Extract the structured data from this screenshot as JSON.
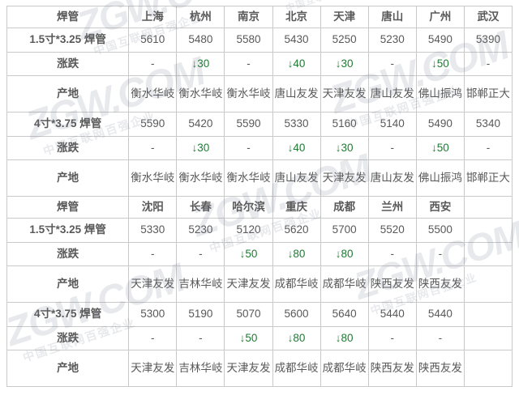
{
  "watermark": {
    "big": "ZGW.COM",
    "small": "中国互联网百强企业"
  },
  "labels": {
    "section_title": "焊管",
    "row_spec_1": "1.5寸*3.25 焊管",
    "row_change": "涨跌",
    "row_origin": "产地",
    "row_spec_2": "4寸*3.75 焊管",
    "blank": ""
  },
  "colors": {
    "section_title": "#ff0000",
    "city": "#1414d2",
    "price": "#666666",
    "change_down": "#1f7a33",
    "border": "#c9c9c9",
    "label": "#404040",
    "origin": "#737373"
  },
  "tables": [
    {
      "id": "table-north-south",
      "cities": [
        "上海",
        "杭州",
        "南京",
        "北京",
        "天津",
        "唐山",
        "广州",
        "武汉"
      ],
      "rows": [
        {
          "spec": "1.5寸*3.25 焊管",
          "prices": [
            "5610",
            "5480",
            "5580",
            "5430",
            "5250",
            "5230",
            "5490",
            "5390"
          ],
          "changes": [
            "-",
            "↓30",
            "-",
            "↓40",
            "↓30",
            "-",
            "↓50",
            "-"
          ],
          "origins": [
            "衡水华岐",
            "衡水华岐",
            "衡水华岐",
            "唐山友发",
            "天津友发",
            "唐山友发",
            "佛山振鸿",
            "邯郸正大"
          ]
        },
        {
          "spec": "4寸*3.75 焊管",
          "prices": [
            "5590",
            "5420",
            "5590",
            "5330",
            "5160",
            "5140",
            "5490",
            "5340"
          ],
          "changes": [
            "-",
            "↓30",
            "-",
            "↓40",
            "↓30",
            "-",
            "↓50",
            "-"
          ],
          "origins": [
            "衡水华岐",
            "衡水华岐",
            "衡水华岐",
            "唐山友发",
            "天津友发",
            "唐山友发",
            "佛山振鸿",
            "邯郸正大"
          ]
        }
      ]
    },
    {
      "id": "table-northeast-west",
      "cities": [
        "沈阳",
        "长春",
        "哈尔滨",
        "重庆",
        "成都",
        "兰州",
        "西安",
        ""
      ],
      "rows": [
        {
          "spec": "1.5寸*3.25 焊管",
          "prices": [
            "5330",
            "5230",
            "5120",
            "5620",
            "5700",
            "5520",
            "5500",
            ""
          ],
          "changes": [
            "-",
            "-",
            "↓50",
            "↓80",
            "↓80",
            "-",
            "-",
            ""
          ],
          "origins": [
            "天津友发",
            "吉林华岐",
            "天津友发",
            "成都华岐",
            "成都华岐",
            "陕西友发",
            "陕西友发",
            ""
          ]
        },
        {
          "spec": "4寸*3.75 焊管",
          "prices": [
            "5300",
            "5190",
            "5070",
            "5600",
            "5640",
            "5440",
            "5440",
            ""
          ],
          "changes": [
            "-",
            "-",
            "↓50",
            "↓80",
            "↓80",
            "-",
            "-",
            ""
          ],
          "origins": [
            "天津友发",
            "吉林华岐",
            "天津友发",
            "成都华岐",
            "成都华岐",
            "陕西友发",
            "陕西友发",
            ""
          ]
        }
      ]
    }
  ]
}
